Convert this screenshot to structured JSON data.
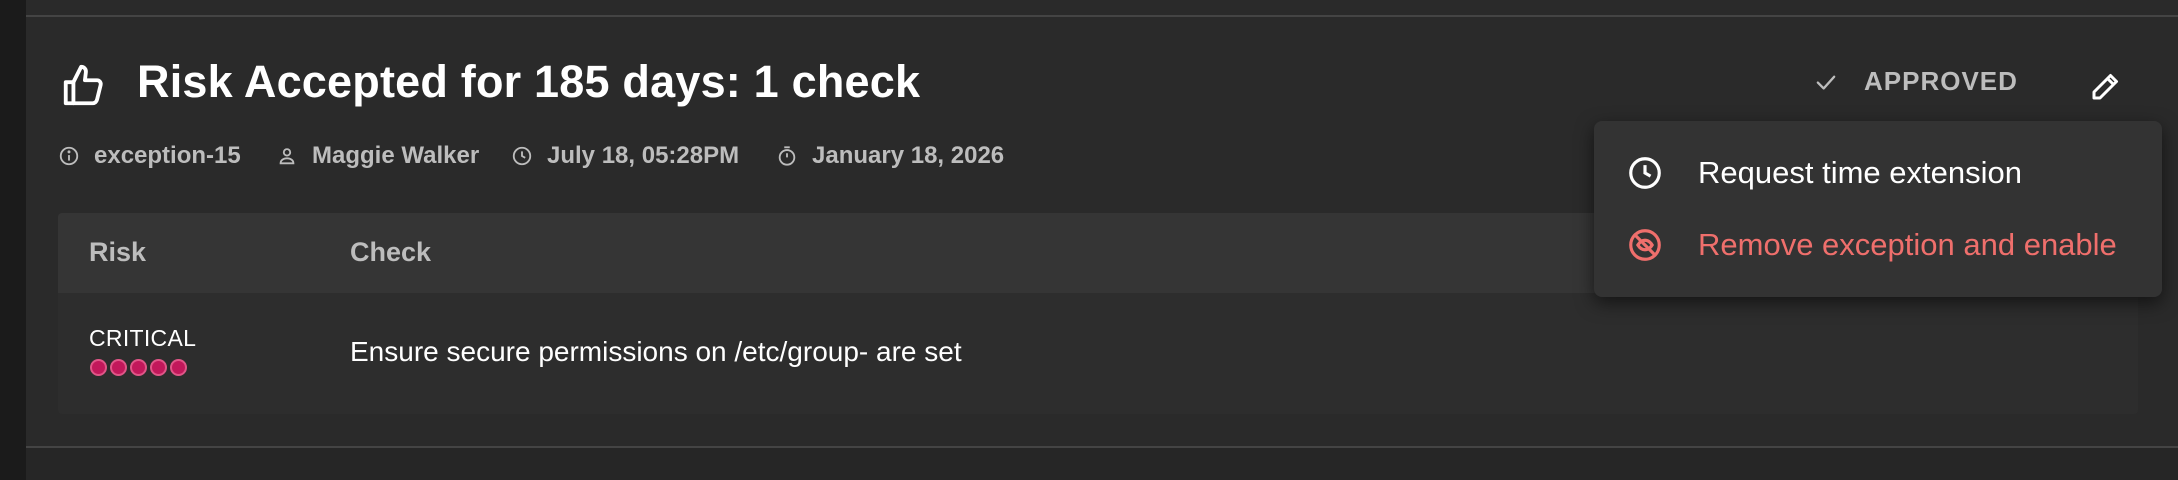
{
  "exception": {
    "title": "Risk Accepted for 185 days: 1 check",
    "title_icon": "thumb-up-icon",
    "meta": {
      "id": "exception-15",
      "id_icon": "info-icon",
      "user": "Maggie Walker",
      "user_icon": "person-icon",
      "created": "July 18, 05:28PM",
      "created_icon": "clock-icon",
      "expires": "January 18, 2026",
      "expires_icon": "timer-icon"
    },
    "status": {
      "label": "APPROVED",
      "icon": "check-icon"
    },
    "edit_icon": "pencil-icon"
  },
  "table": {
    "columns": [
      "Risk",
      "Check"
    ],
    "rows": [
      {
        "risk_level": "CRITICAL",
        "risk_score": 5,
        "risk_max": 5,
        "check": "Ensure secure permissions on /etc/group- are set"
      }
    ]
  },
  "menu": {
    "items": [
      {
        "label": "Request time extension",
        "icon": "clock-icon"
      },
      {
        "label": "Remove exception and enable",
        "icon": "eye-off-icon"
      }
    ]
  },
  "colors": {
    "panel_bg": "#2a2a2a",
    "critical_dot": "#c2185b",
    "danger_text": "#ef6f6c",
    "muted_text": "#bdbdbd"
  }
}
